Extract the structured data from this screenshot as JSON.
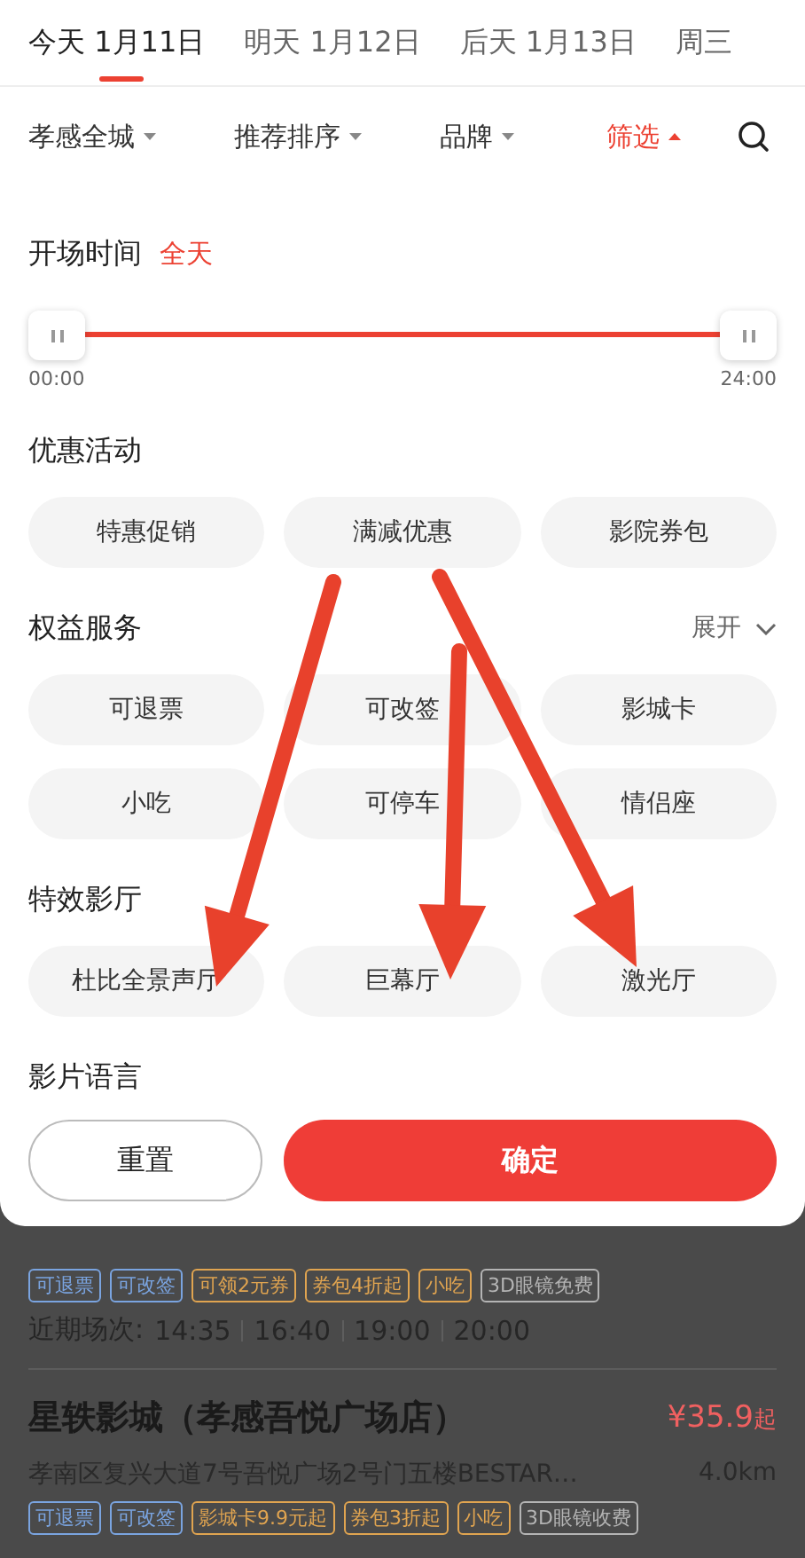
{
  "date_tabs": [
    {
      "label": "今天 1月11日",
      "selected": true
    },
    {
      "label": "明天 1月12日",
      "selected": false
    },
    {
      "label": "后天 1月13日",
      "selected": false
    },
    {
      "label": "周三",
      "selected": false
    }
  ],
  "filter_bar": [
    {
      "label": "孝感全城",
      "selected": false
    },
    {
      "label": "推荐排序",
      "selected": false
    },
    {
      "label": "品牌",
      "selected": false
    },
    {
      "label": "筛选",
      "selected": true
    }
  ],
  "time_filter": {
    "title": "开场时间",
    "value": "全天",
    "handles": [
      {
        "level": 0
      },
      {
        "level": 1
      }
    ],
    "start_label": "00:00",
    "end_label": "24:00"
  },
  "sections": [
    {
      "title": "优惠活动",
      "chips": [
        {
          "label": "特惠促销",
          "selected": false
        },
        {
          "label": "满减优惠",
          "selected": false
        },
        {
          "label": "影院券包",
          "selected": false
        }
      ]
    },
    {
      "title": "权益服务",
      "expand": "展开",
      "chips": [
        {
          "label": "可退票",
          "selected": false
        },
        {
          "label": "可改签",
          "selected": false
        },
        {
          "label": "影城卡",
          "selected": false
        },
        {
          "label": "小吃",
          "selected": false
        },
        {
          "label": "可停车",
          "selected": false
        },
        {
          "label": "情侣座",
          "selected": false
        }
      ]
    },
    {
      "title": "特效影厅",
      "chips": [
        {
          "label": "杜比全景声厅",
          "selected": false
        },
        {
          "label": "巨幕厅",
          "selected": false
        },
        {
          "label": "激光厅",
          "selected": false
        }
      ]
    },
    {
      "title": "影片语言"
    }
  ],
  "buttons": [
    {
      "label": "重置",
      "kind": "secondary"
    },
    {
      "label": "确定",
      "kind": "primary"
    }
  ],
  "cinema_list": [
    {
      "tags": [
        {
          "label": "可退票",
          "color": "#7aa4e0"
        },
        {
          "label": "可改签",
          "color": "#7aa4e0"
        },
        {
          "label": "可领2元券",
          "color": "#e0a450"
        },
        {
          "label": "券包4折起",
          "color": "#e0a450"
        },
        {
          "label": "小吃",
          "color": "#e0a450"
        },
        {
          "label": "3D眼镜免费",
          "color": "#b4b4b4"
        }
      ],
      "showtimes_label": "近期场次:",
      "showtimes": [
        "14:35",
        "16:40",
        "19:00",
        "20:00"
      ]
    },
    {
      "name": "星轶影城（孝感吾悦广场店）",
      "price": "¥35.9",
      "price_suffix": "起",
      "address": "孝南区复兴大道7号吾悦广场2号门五楼BESTAR…",
      "distance": "4.0km",
      "tags": [
        {
          "label": "可退票",
          "color": "#7aa4e0"
        },
        {
          "label": "可改签",
          "color": "#7aa4e0"
        },
        {
          "label": "影城卡9.9元起",
          "color": "#e0a450"
        },
        {
          "label": "券包3折起",
          "color": "#e0a450"
        },
        {
          "label": "小吃",
          "color": "#e0a450"
        },
        {
          "label": "3D眼镜收费",
          "color": "#b4b4b4"
        }
      ]
    }
  ],
  "annotation_arrows": [
    {
      "kind": "arrow"
    },
    {
      "kind": "arrow"
    },
    {
      "kind": "arrow"
    }
  ]
}
